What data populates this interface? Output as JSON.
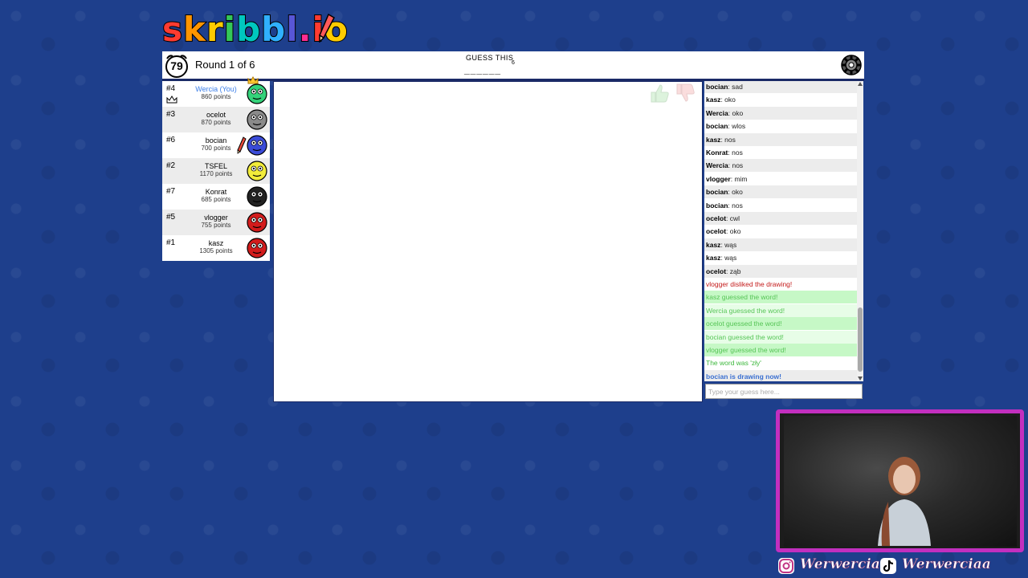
{
  "logo": {
    "letters": [
      "s",
      "k",
      "r",
      "i",
      "b",
      "b",
      "l",
      ".",
      "i",
      "o"
    ],
    "colors": [
      "#ff3b30",
      "#ff9500",
      "#ffcc00",
      "#34c759",
      "#00c7be",
      "#30b0ff",
      "#5856d6",
      "#ff2d92",
      "#ff3b30",
      "#ffcc00"
    ]
  },
  "topbar": {
    "timer": "79",
    "round_text": "Round 1 of 6",
    "guess_label": "GUESS THIS",
    "word_length": "6",
    "word_blanks": "______"
  },
  "players": [
    {
      "rank": "#4",
      "name": "Wercia (You)",
      "points": "860 points",
      "avatar_color": "#34d27a",
      "is_me": true,
      "owner": true
    },
    {
      "rank": "#3",
      "name": "ocelot",
      "points": "870 points",
      "avatar_color": "#8a8a8a",
      "is_me": false
    },
    {
      "rank": "#6",
      "name": "bocian",
      "points": "700 points",
      "avatar_color": "#3a4bd8",
      "is_me": false,
      "drawing": true
    },
    {
      "rank": "#2",
      "name": "TSFEL",
      "points": "1170 points",
      "avatar_color": "#f2ec3a",
      "is_me": false
    },
    {
      "rank": "#7",
      "name": "Konrat",
      "points": "685 points",
      "avatar_color": "#222222",
      "is_me": false
    },
    {
      "rank": "#5",
      "name": "vlogger",
      "points": "755 points",
      "avatar_color": "#d21c1c",
      "is_me": false
    },
    {
      "rank": "#1",
      "name": "kasz",
      "points": "1305 points",
      "avatar_color": "#d21c1c",
      "is_me": false
    }
  ],
  "chat": [
    {
      "author": "bocian",
      "text": "sad",
      "type": "normal"
    },
    {
      "author": "kasz",
      "text": "oko",
      "type": "normal"
    },
    {
      "author": "Wercia",
      "text": "oko",
      "type": "normal"
    },
    {
      "author": "bocian",
      "text": "wlos",
      "type": "normal"
    },
    {
      "author": "kasz",
      "text": "nos",
      "type": "normal"
    },
    {
      "author": "Konrat",
      "text": "nos",
      "type": "normal"
    },
    {
      "author": "Wercia",
      "text": "nos",
      "type": "normal"
    },
    {
      "author": "vlogger",
      "text": "mim",
      "type": "normal"
    },
    {
      "author": "bocian",
      "text": "oko",
      "type": "normal"
    },
    {
      "author": "bocian",
      "text": "nos",
      "type": "normal"
    },
    {
      "author": "ocelot",
      "text": "cwl",
      "type": "normal"
    },
    {
      "author": "ocelot",
      "text": "oko",
      "type": "normal"
    },
    {
      "author": "kasz",
      "text": "wąs",
      "type": "normal"
    },
    {
      "author": "kasz",
      "text": "wąs",
      "type": "normal"
    },
    {
      "author": "ocelot",
      "text": "ząb",
      "type": "normal"
    },
    {
      "text": "vlogger disliked the drawing!",
      "type": "red"
    },
    {
      "text": "kasz guessed the word!",
      "type": "green"
    },
    {
      "text": "Wercia guessed the word!",
      "type": "green"
    },
    {
      "text": "ocelot guessed the word!",
      "type": "green"
    },
    {
      "text": "bocian guessed the word!",
      "type": "green"
    },
    {
      "text": "vlogger guessed the word!",
      "type": "green"
    },
    {
      "text": "The word was 'zły'",
      "type": "darkgreen"
    },
    {
      "text": "bocian is drawing now!",
      "type": "blue"
    }
  ],
  "chat_input": {
    "placeholder": "Type your guess here..."
  },
  "socials": {
    "instagram_handle": "Werwerciaa",
    "tiktok_handle": "Werwerciaa"
  },
  "colors": {
    "background": "#1e3f8c",
    "webcam_border": "#c22fbf",
    "accent_blue": "#3a7ee8"
  }
}
